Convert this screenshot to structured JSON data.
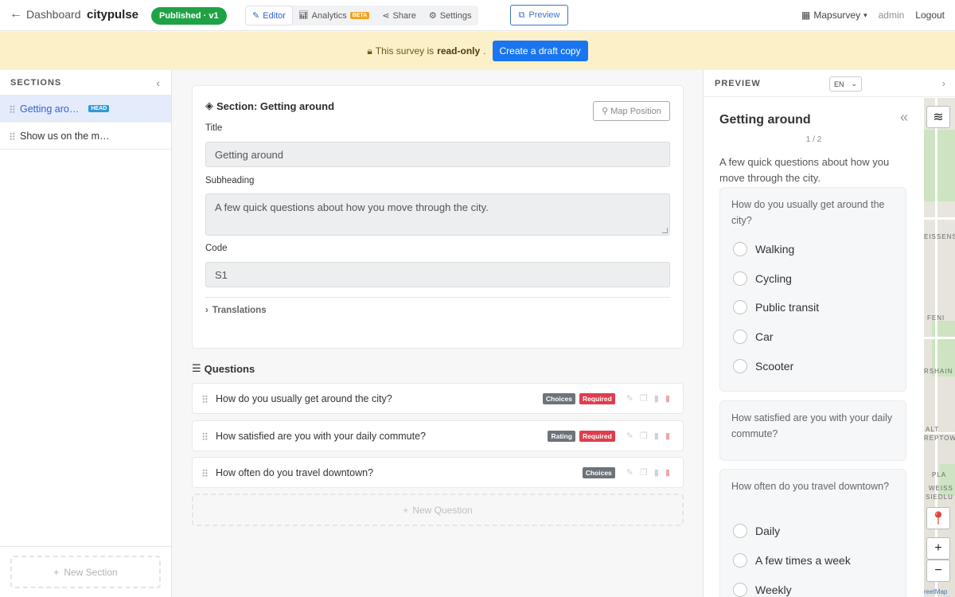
{
  "topbar": {
    "back_label": "Dashboard",
    "app_name": "citypulse",
    "status_badge": "Published · v1",
    "tabs": [
      {
        "label": "Editor",
        "active": true
      },
      {
        "label": "Analytics",
        "badge": "BETA"
      },
      {
        "label": "Share"
      },
      {
        "label": "Settings"
      }
    ],
    "preview_label": "Preview",
    "brand": "Mapsurvey",
    "user": "admin",
    "logout": "Logout"
  },
  "banner": {
    "text_pre": "This survey is",
    "text_bold": "read-only",
    "text_post": ".",
    "button": "Create a draft copy"
  },
  "sidebar": {
    "title": "SECTIONS",
    "items": [
      {
        "label": "Getting aro…",
        "badge": "HEAD",
        "active": true
      },
      {
        "label": "Show us on the m…",
        "active": false
      }
    ],
    "new_section": "New Section"
  },
  "editor": {
    "section_title": "Section: Getting around",
    "map_position": "Map Position",
    "title_label": "Title",
    "title_value": "Getting around",
    "subheading_label": "Subheading",
    "subheading_value": "A few quick questions about how you move through the city.",
    "code_label": "Code",
    "code_value": "S1",
    "translations": "Translations",
    "questions_heading": "Questions",
    "questions": [
      {
        "text": "How do you usually get around the city?",
        "type": "Choices",
        "required": "Required"
      },
      {
        "text": "How satisfied are you with your daily commute?",
        "type": "Rating",
        "required": "Required"
      },
      {
        "text": "How often do you travel downtown?",
        "type": "Choices",
        "required": null
      }
    ],
    "new_question": "New Question"
  },
  "preview": {
    "title": "PREVIEW",
    "lang": "EN",
    "section_title": "Getting around",
    "page": "1 / 2",
    "subheading": "A few quick questions about how you move through the city.",
    "q1": {
      "label": "How do you usually get around the city?",
      "options": [
        "Walking",
        "Cycling",
        "Public transit",
        "Car",
        "Scooter"
      ]
    },
    "q2": {
      "label": "How satisfied are you with your daily commute?"
    },
    "q3": {
      "label": "How often do you travel downtown?",
      "options": [
        "Daily",
        "A few times a week",
        "Weekly"
      ]
    },
    "map_labels": [
      "EISSENS",
      "FENI",
      "RSHAIN",
      "ALT",
      "REPTOW",
      "PLA",
      "WEISS",
      "SIEDLU"
    ],
    "map_credit": "reetMap"
  },
  "colors": {
    "accent": "#1976f0",
    "published": "#1fa245",
    "banner_bg": "#fcf0c8",
    "required": "#e03d4c",
    "head_badge": "#2f9ad6",
    "beta": "#f3a31c"
  }
}
